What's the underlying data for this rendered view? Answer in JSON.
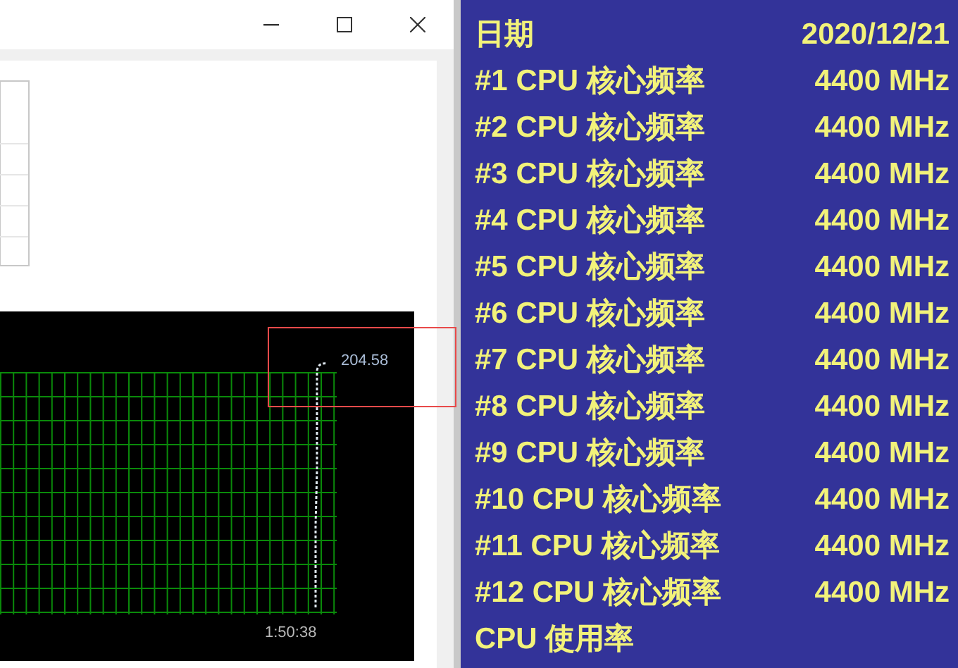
{
  "window": {
    "controls": [
      {
        "kind": "minimize"
      },
      {
        "kind": "maximize"
      },
      {
        "kind": "close"
      }
    ]
  },
  "chart": {
    "peak_label": "204.58",
    "time_label": "1:50:38"
  },
  "panel": {
    "rows": [
      {
        "label": "日期",
        "value": "2020/12/21"
      },
      {
        "label": "#1 CPU 核心频率",
        "value": "4400 MHz"
      },
      {
        "label": "#2 CPU 核心频率",
        "value": "4400 MHz"
      },
      {
        "label": "#3 CPU 核心频率",
        "value": "4400 MHz"
      },
      {
        "label": "#4 CPU 核心频率",
        "value": "4400 MHz"
      },
      {
        "label": "#5 CPU 核心频率",
        "value": "4400 MHz"
      },
      {
        "label": "#6 CPU 核心频率",
        "value": "4400 MHz"
      },
      {
        "label": "#7 CPU 核心频率",
        "value": "4400 MHz"
      },
      {
        "label": "#8 CPU 核心频率",
        "value": "4400 MHz"
      },
      {
        "label": "#9 CPU 核心频率",
        "value": "4400 MHz"
      },
      {
        "label": "#10 CPU 核心频率",
        "value": "4400 MHz"
      },
      {
        "label": "#11 CPU 核心频率",
        "value": "4400 MHz"
      },
      {
        "label": "#12 CPU 核心频率",
        "value": "4400 MHz"
      },
      {
        "label": "CPU 使用率"
      }
    ]
  }
}
